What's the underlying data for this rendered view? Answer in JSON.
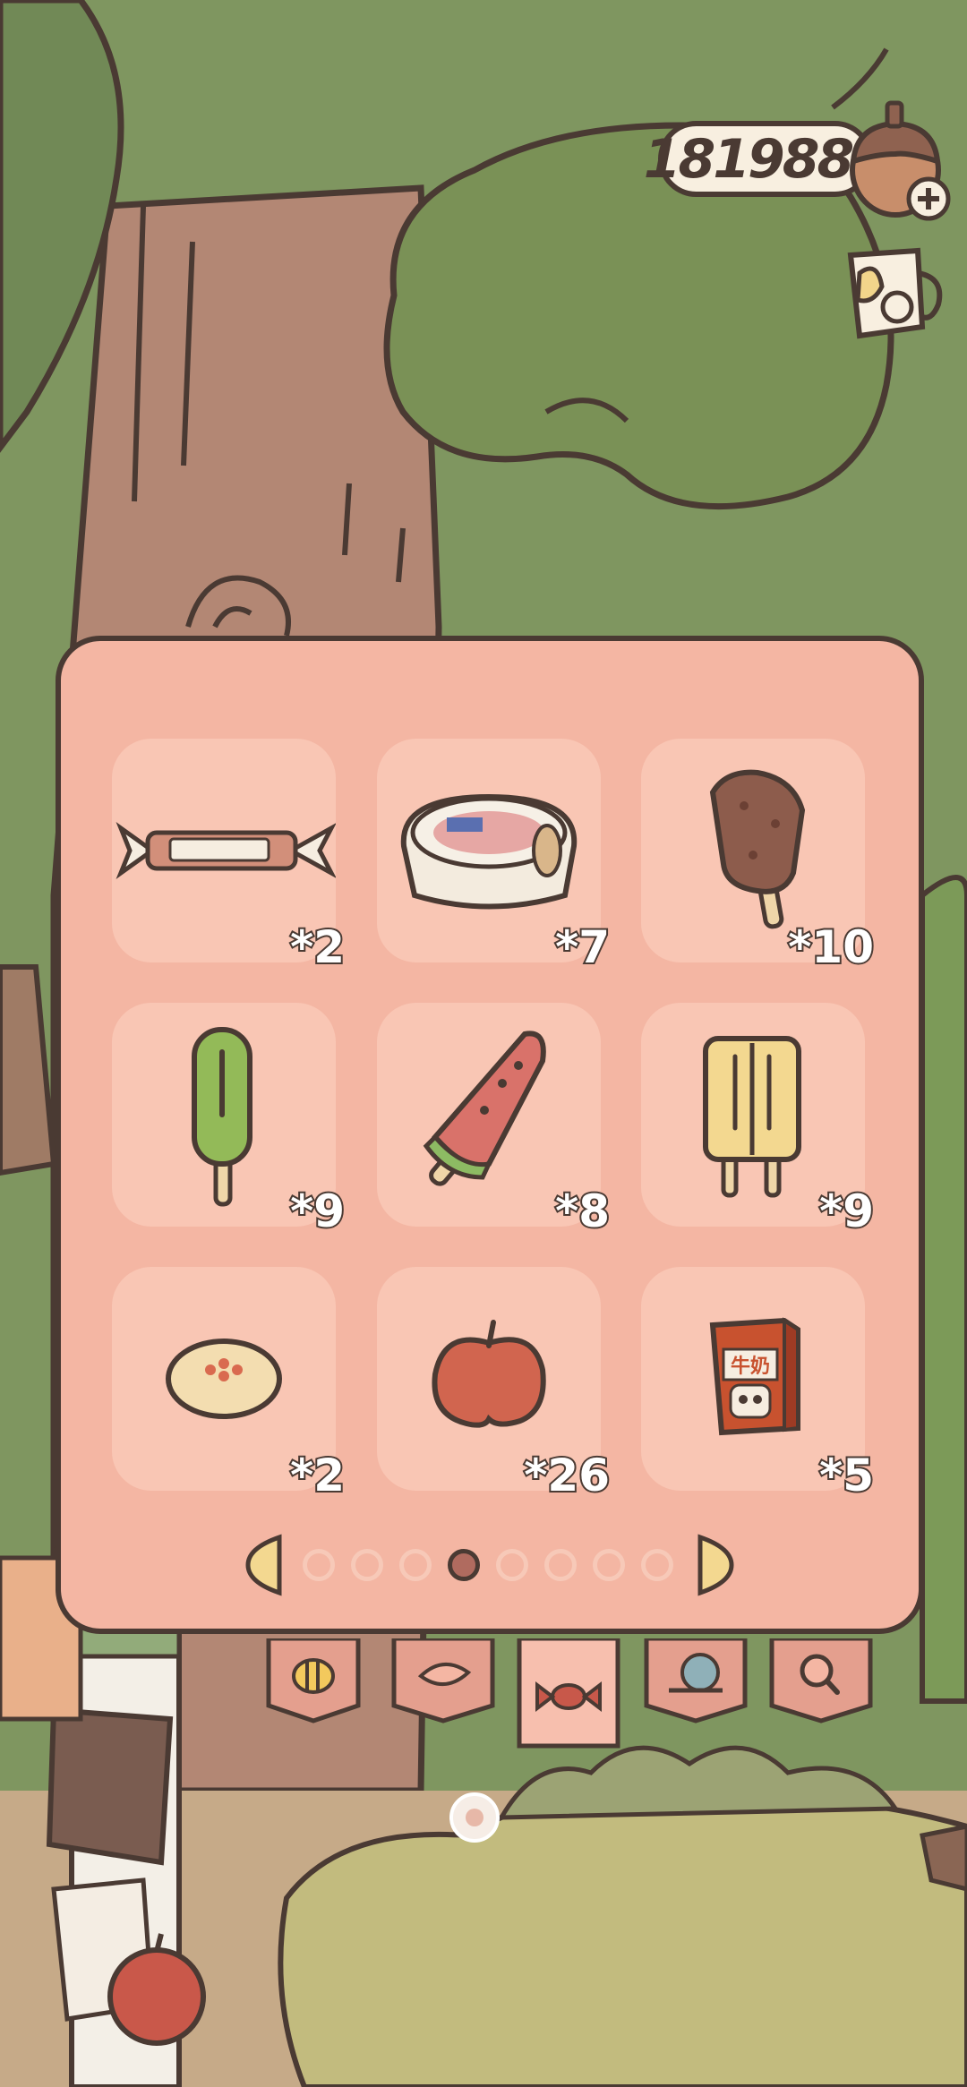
{
  "currency": {
    "amount": "181988",
    "icon": "acorn-icon",
    "add_icon": "plus-icon"
  },
  "mug_button": {
    "icon": "mug-icon"
  },
  "inventory": {
    "items": [
      {
        "name": "candy-bar-item",
        "count": "*2"
      },
      {
        "name": "ice-cream-tub-item",
        "count": "*7"
      },
      {
        "name": "chocolate-ice-bar-item",
        "count": "*10"
      },
      {
        "name": "green-popsicle-item",
        "count": "*9"
      },
      {
        "name": "watermelon-popsicle-item",
        "count": "*8"
      },
      {
        "name": "twin-popsicle-item",
        "count": "*9"
      },
      {
        "name": "bun-item",
        "count": "*2"
      },
      {
        "name": "apple-item",
        "count": "*26"
      },
      {
        "name": "milk-carton-item",
        "count": "*5"
      }
    ],
    "carton_label": "牛奶"
  },
  "pagination": {
    "total_pages": 8,
    "current_page": 4
  },
  "tabs": [
    {
      "icon": "bee-icon"
    },
    {
      "icon": "leaf-icon"
    },
    {
      "icon": "candy-icon"
    },
    {
      "icon": "snail-icon"
    },
    {
      "icon": "magnifier-icon"
    }
  ],
  "colors": {
    "panel": "#f4b6a3",
    "slot": "#f9c6b4",
    "outline": "#4a3a33",
    "active_dot": "#b06b5f"
  }
}
